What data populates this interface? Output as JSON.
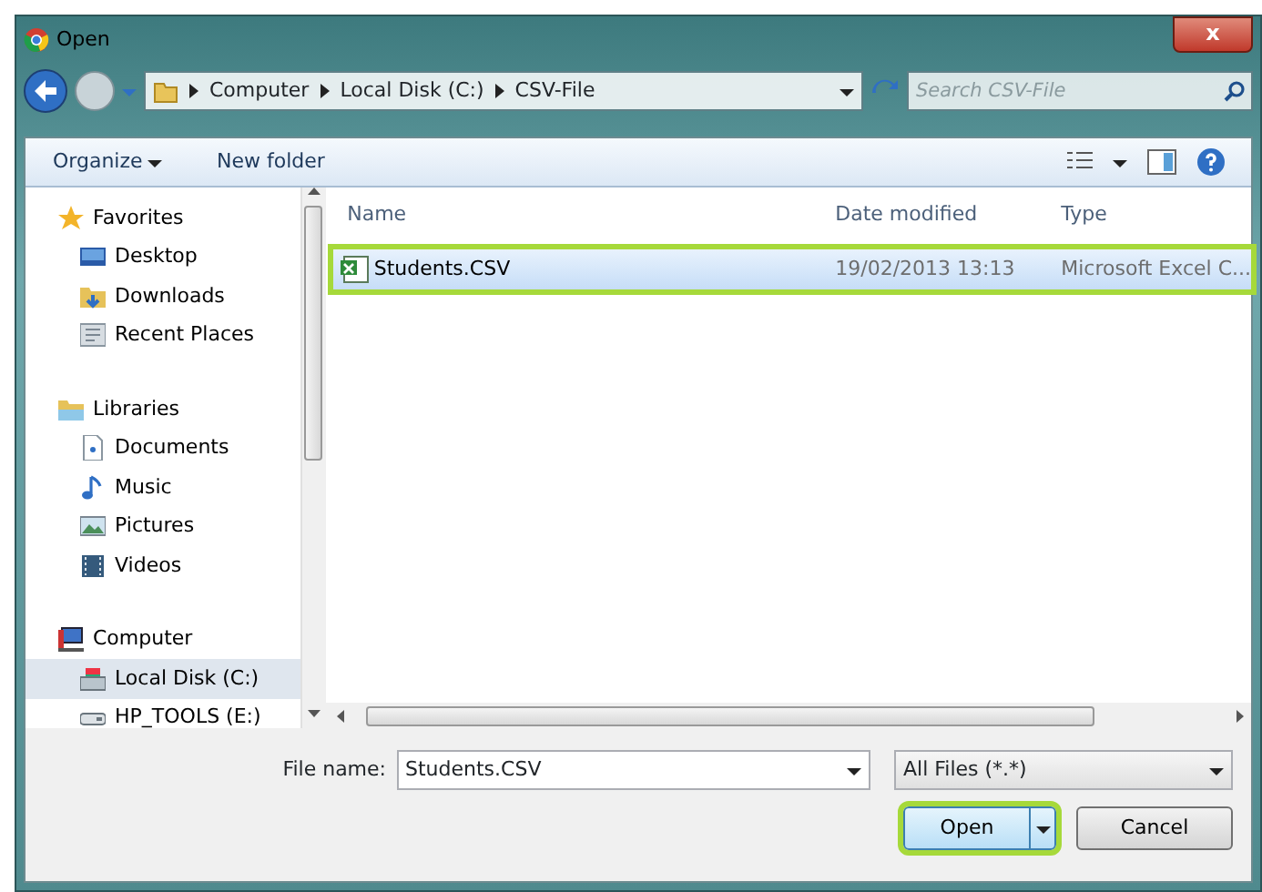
{
  "window": {
    "title": "Open",
    "close": "x"
  },
  "address": {
    "crumbs": [
      "Computer",
      "Local Disk (C:)",
      "CSV-File"
    ],
    "search_placeholder": "Search CSV-File"
  },
  "toolbar": {
    "organize": "Organize",
    "new_folder": "New folder"
  },
  "sidebar": {
    "items": [
      {
        "label": "Favorites",
        "kind": "group",
        "selected": false
      },
      {
        "label": "Desktop",
        "kind": "item",
        "selected": false
      },
      {
        "label": "Downloads",
        "kind": "item",
        "selected": false
      },
      {
        "label": "Recent Places",
        "kind": "item",
        "selected": false
      },
      {
        "label": "Libraries",
        "kind": "group",
        "selected": false
      },
      {
        "label": "Documents",
        "kind": "item",
        "selected": false
      },
      {
        "label": "Music",
        "kind": "item",
        "selected": false
      },
      {
        "label": "Pictures",
        "kind": "item",
        "selected": false
      },
      {
        "label": "Videos",
        "kind": "item",
        "selected": false
      },
      {
        "label": "Computer",
        "kind": "group",
        "selected": false
      },
      {
        "label": "Local Disk (C:)",
        "kind": "item",
        "selected": true
      },
      {
        "label": "HP_TOOLS (E:)",
        "kind": "item",
        "selected": false
      }
    ]
  },
  "table": {
    "columns": [
      "Name",
      "Date modified",
      "Type"
    ],
    "rows": [
      {
        "cells": [
          "Students.CSV",
          "19/02/2013 13:13",
          "Microsoft Excel C..."
        ],
        "selected": true,
        "highlighted": true
      }
    ]
  },
  "footer": {
    "file_name_label": "File name:",
    "file_name": "Students.CSV",
    "filter": "All Files (*.*)",
    "buttons": [
      {
        "label": "Open",
        "kind": "split",
        "highlighted": true
      },
      {
        "label": "Cancel",
        "kind": "plain",
        "highlighted": false
      }
    ]
  }
}
